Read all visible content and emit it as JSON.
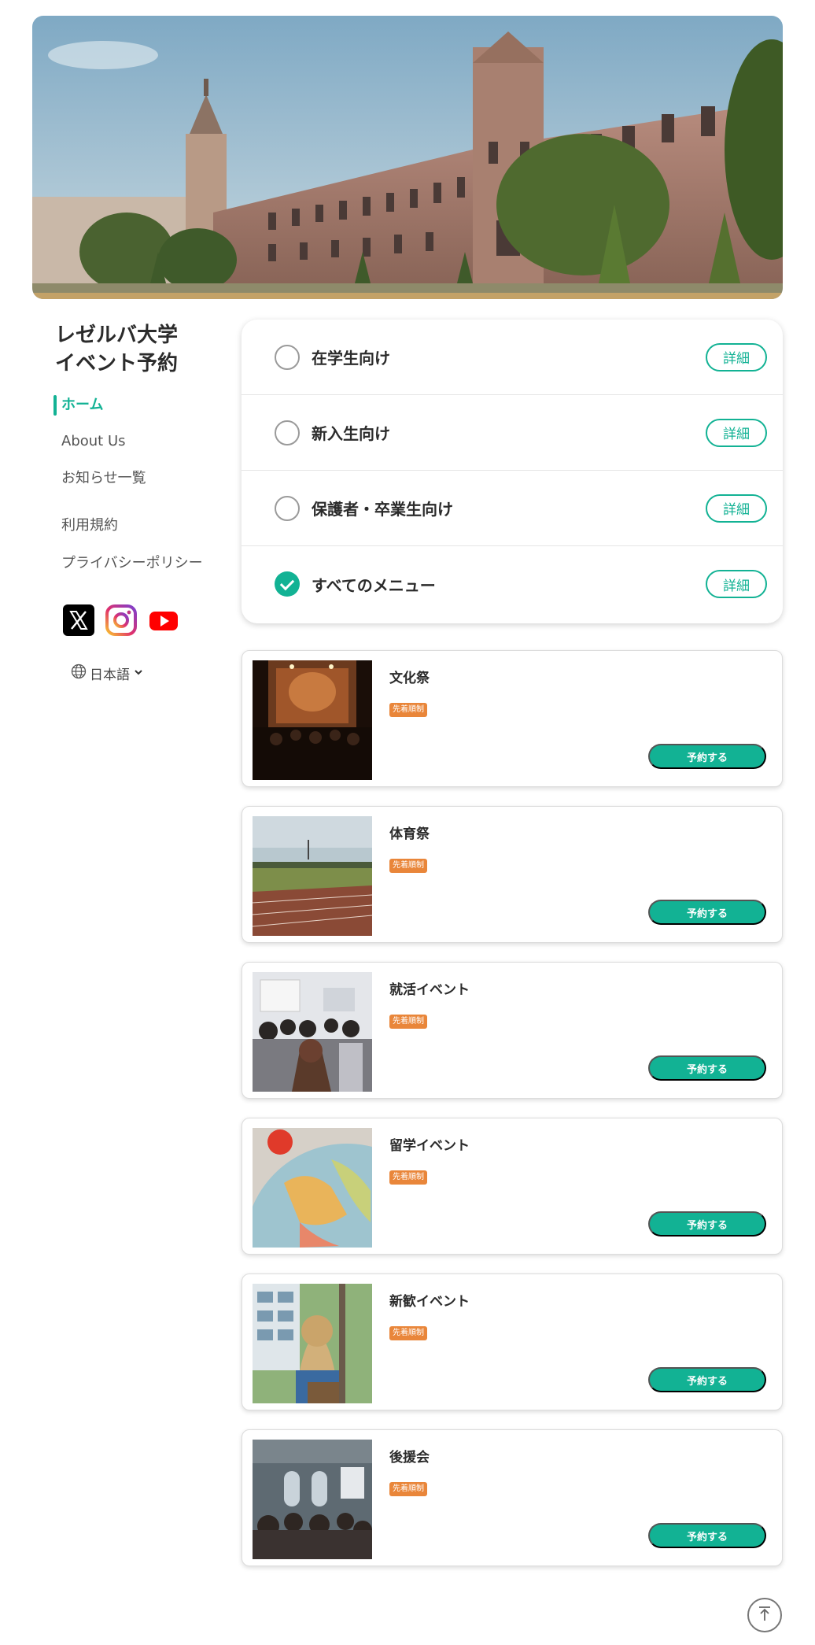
{
  "site": {
    "title": "レゼルバ大学\nイベント予約"
  },
  "nav": {
    "home": "ホーム",
    "about": "About Us",
    "news": "お知らせ一覧",
    "terms": "利用規約",
    "privacy": "プライバシーポリシー"
  },
  "socials": [
    "x-icon",
    "instagram-icon",
    "youtube-icon"
  ],
  "language": {
    "selected": "日本語"
  },
  "menu": {
    "detail_label": "詳細",
    "items": [
      {
        "label": "在学生向け",
        "checked": false
      },
      {
        "label": "新入生向け",
        "checked": false
      },
      {
        "label": "保護者・卒業生向け",
        "checked": false
      },
      {
        "label": "すべてのメニュー",
        "checked": true
      }
    ]
  },
  "events": {
    "reserve_label": "予約する",
    "items": [
      {
        "title": "文化祭",
        "badge": "先着順制"
      },
      {
        "title": "体育祭",
        "badge": "先着順制"
      },
      {
        "title": "就活イベント",
        "badge": "先着順制"
      },
      {
        "title": "留学イベント",
        "badge": "先着順制"
      },
      {
        "title": "新歓イベント",
        "badge": "先着順制"
      },
      {
        "title": "後援会",
        "badge": "先着順制"
      }
    ]
  },
  "colors": {
    "accent": "#12b294",
    "badge": "#e9863a"
  }
}
